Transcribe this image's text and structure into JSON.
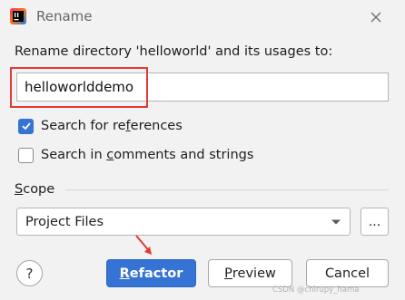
{
  "window": {
    "title": "Rename",
    "app_icon": "intellij-icon",
    "close_icon": "close-icon"
  },
  "prompt": "Rename directory 'helloworld' and its usages to:",
  "name_field": {
    "value": "helloworlddemo"
  },
  "options": {
    "search_references": {
      "label_pre": "Search for re",
      "label_mn": "f",
      "label_post": "erences",
      "checked": true
    },
    "search_comments": {
      "label_pre": "Search in ",
      "label_mn": "c",
      "label_post": "omments and strings",
      "checked": false
    }
  },
  "scope": {
    "label_mn": "S",
    "label_rest": "cope",
    "selected": "Project Files",
    "more_label": "..."
  },
  "buttons": {
    "help_label": "?",
    "refactor": {
      "mn": "R",
      "rest": "efactor"
    },
    "preview": {
      "mn": "P",
      "rest": "review"
    },
    "cancel": {
      "label": "Cancel"
    }
  },
  "colors": {
    "accent": "#3574d4",
    "highlight_box": "#e53935",
    "arrow": "#e53935"
  },
  "watermark": "CSDN @chirupy_hama"
}
